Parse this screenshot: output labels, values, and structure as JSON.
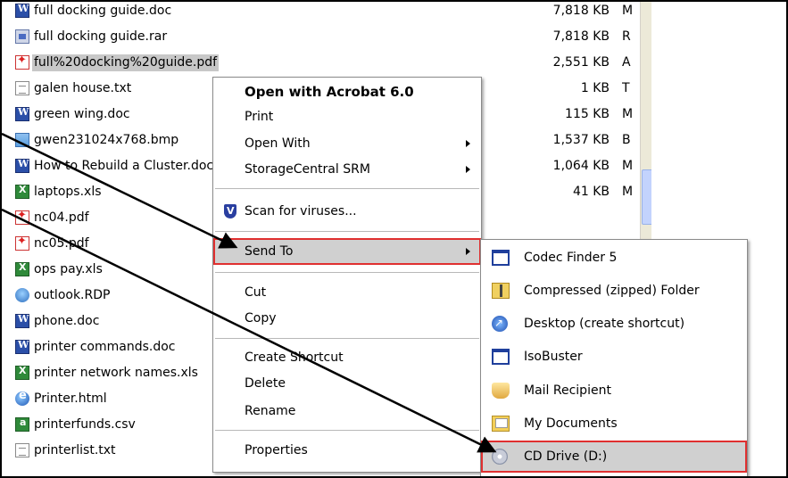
{
  "files": [
    {
      "name": "full docking guide.doc",
      "size": "7,818 KB",
      "type": "M",
      "icon": "word-icon"
    },
    {
      "name": "full docking guide.rar",
      "size": "7,818 KB",
      "type": "R",
      "icon": "rar-icon"
    },
    {
      "name": "full%20docking%20guide.pdf",
      "size": "2,551 KB",
      "type": "A",
      "icon": "pdf-icon",
      "selected": true
    },
    {
      "name": "galen house.txt",
      "size": "1 KB",
      "type": "T",
      "icon": "txt-icon"
    },
    {
      "name": "green wing.doc",
      "size": "115 KB",
      "type": "M",
      "icon": "word-icon"
    },
    {
      "name": "gwen231024x768.bmp",
      "size": "1,537 KB",
      "type": "B",
      "icon": "bmp-icon"
    },
    {
      "name": "How to Rebuild a Cluster.doc",
      "size": "1,064 KB",
      "type": "M",
      "icon": "word-icon"
    },
    {
      "name": "laptops.xls",
      "size": "41 KB",
      "type": "M",
      "icon": "excel-icon"
    },
    {
      "name": "nc04.pdf",
      "size": "",
      "type": "",
      "icon": "pdf-icon"
    },
    {
      "name": "nc05.pdf",
      "size": "",
      "type": "",
      "icon": "pdf-icon"
    },
    {
      "name": "ops pay.xls",
      "size": "",
      "type": "",
      "icon": "excel-icon"
    },
    {
      "name": "outlook.RDP",
      "size": "",
      "type": "",
      "icon": "rdp-icon"
    },
    {
      "name": "phone.doc",
      "size": "",
      "type": "",
      "icon": "word-icon"
    },
    {
      "name": "printer commands.doc",
      "size": "",
      "type": "",
      "icon": "word-icon"
    },
    {
      "name": "printer network names.xls",
      "size": "",
      "type": "",
      "icon": "excel-icon"
    },
    {
      "name": "Printer.html",
      "size": "",
      "type": "",
      "icon": "ie-icon"
    },
    {
      "name": "printerfunds.csv",
      "size": "",
      "type": "",
      "icon": "csv-icon"
    },
    {
      "name": "printerlist.txt",
      "size": "",
      "type": "",
      "icon": "txt-icon"
    }
  ],
  "context_menu": {
    "open_default": "Open with Acrobat 6.0",
    "print": "Print",
    "open_with": "Open With",
    "storagecentral": "StorageCentral SRM",
    "scan": "Scan for viruses...",
    "send_to": "Send To",
    "cut": "Cut",
    "copy": "Copy",
    "create_shortcut": "Create Shortcut",
    "delete": "Delete",
    "rename": "Rename",
    "properties": "Properties"
  },
  "send_to_menu": {
    "codec_finder": "Codec Finder 5",
    "compressed": "Compressed (zipped) Folder",
    "desktop": "Desktop (create shortcut)",
    "isobuster": "IsoBuster",
    "mail": "Mail Recipient",
    "my_documents": "My Documents",
    "cd_drive": "CD Drive (D:)"
  },
  "colors": {
    "highlight_outline": "#e03030",
    "highlight_fill": "#d0d0d0",
    "selection": "#c8c8c8"
  }
}
